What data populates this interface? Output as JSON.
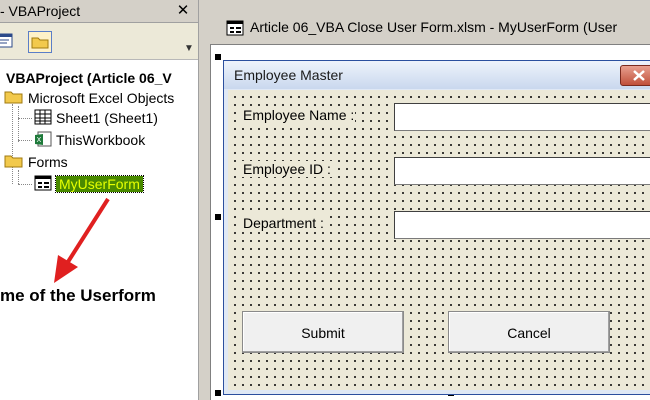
{
  "explorer": {
    "title": "- VBAProject",
    "close_glyph": "✕",
    "tree": {
      "root": "VBAProject (Article 06_V",
      "excel_objects": "Microsoft Excel Objects",
      "sheet1": "Sheet1 (Sheet1)",
      "thisworkbook": "ThisWorkbook",
      "forms": "Forms",
      "myuserform": "MyUserForm"
    }
  },
  "annotation": {
    "text": "me of the Userform",
    "color": "#e02020"
  },
  "designer": {
    "title": "Article 06_VBA Close User Form.xlsm - MyUserForm (User"
  },
  "userform": {
    "title": "Employee Master",
    "labels": {
      "employee_name": "Employee Name :",
      "employee_id": "Employee ID :",
      "department": "Department :"
    },
    "inputs": {
      "employee_name": "",
      "employee_id": "",
      "department": ""
    },
    "buttons": {
      "submit": "Submit",
      "cancel": "Cancel"
    }
  },
  "colors": {
    "selected_node_bg": "#4a8a00",
    "selected_node_text": "#e5ff00",
    "form_border": "#2b4f9e",
    "close_button": "#c0503a"
  },
  "icons": {
    "view_code": "view-code-icon",
    "toggle_folders": "folder-icon",
    "folder": "folder-icon",
    "worksheet": "worksheet-icon",
    "workbook": "excel-workbook-icon",
    "userform": "userform-icon"
  }
}
